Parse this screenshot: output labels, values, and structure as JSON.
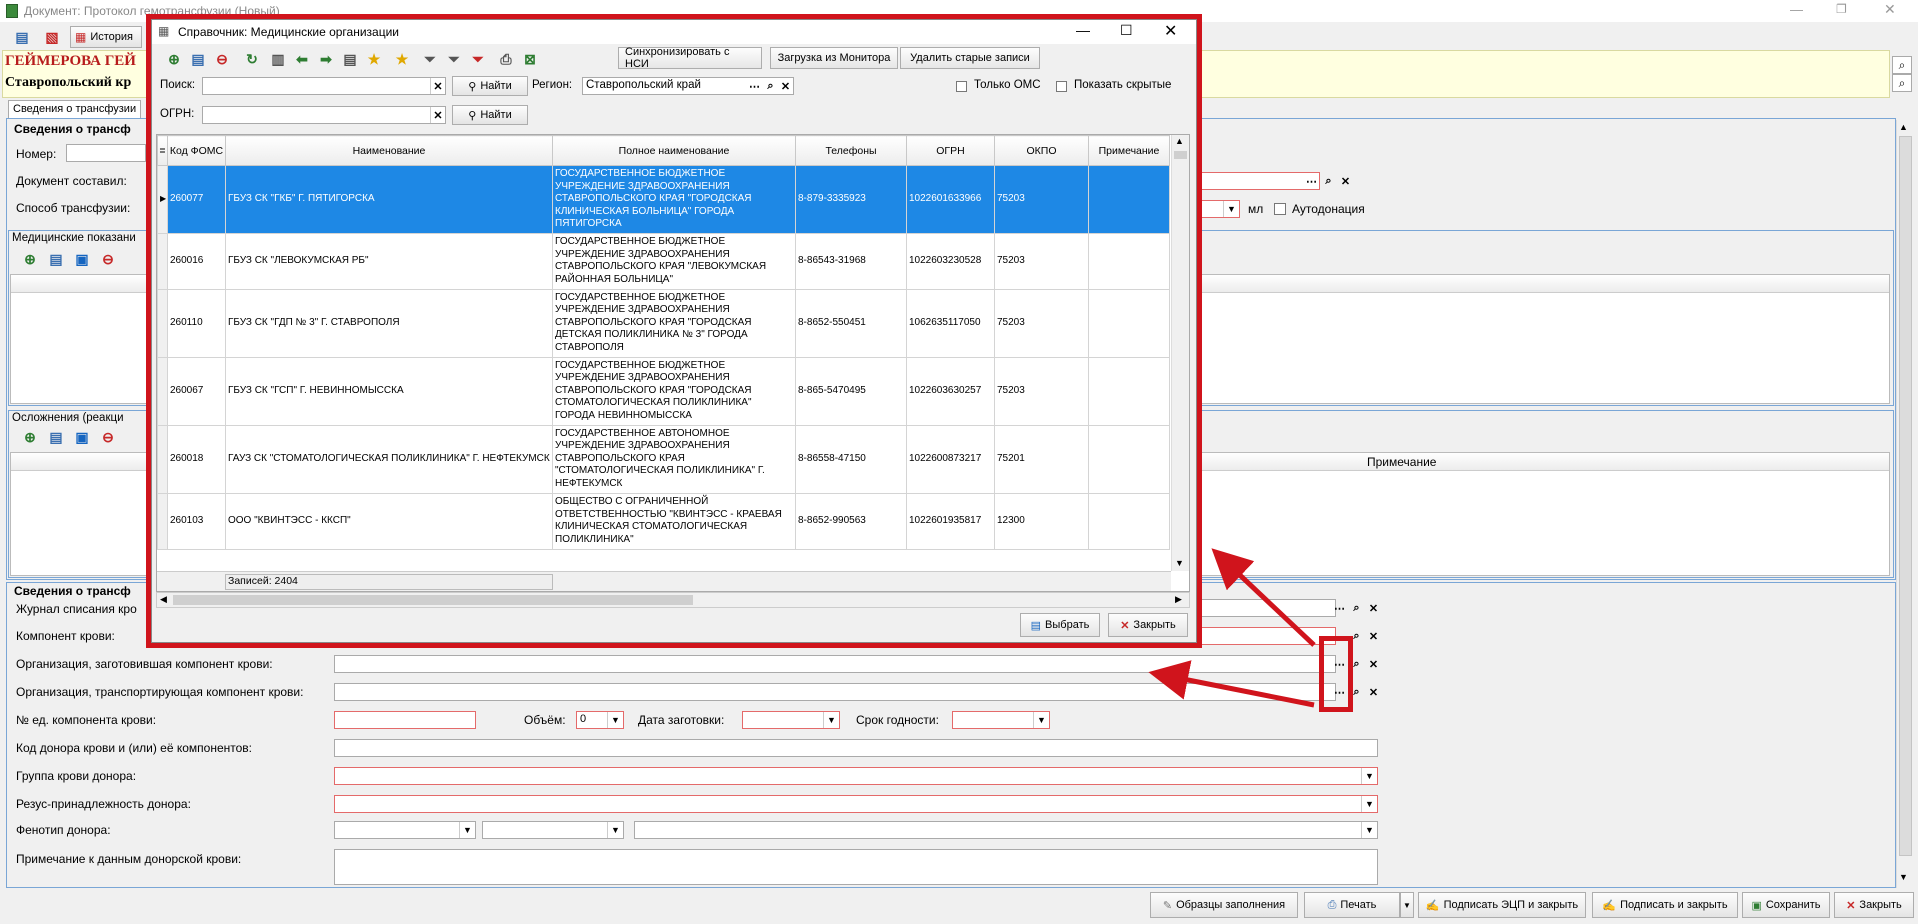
{
  "window": {
    "title": "Документ: Протокол гемотрансфузии (Новый)"
  },
  "toolbar": {
    "history_label": "История"
  },
  "header": {
    "line1": "ГЕЙМЕРОВА ГЕЙ",
    "line2": "Ставропольский кр"
  },
  "tabs": {
    "tab1": "Сведения о трансфузии"
  },
  "section1": {
    "title": "Сведения о трансф",
    "number_label": "Номер:",
    "doc_author_label": "Документ составил:",
    "method_label": "Способ трансфузии:",
    "ml_label": "мл",
    "autodonation_label": "Аутодонация"
  },
  "med_indications": {
    "title": "Медицинские показани"
  },
  "complications": {
    "title": "Осложнения (реакци",
    "note_header": "Примечание"
  },
  "section2": {
    "title": "Сведения о трансф",
    "journal_label": "Журнал списания кро",
    "component_label": "Компонент крови:",
    "org_prepared_label": "Организация, заготовившая компонент крови:",
    "org_transport_label": "Организация, транспортирующая компонент крови:",
    "unit_no_label": "№ ед. компонента крови:",
    "volume_label": "Объём:",
    "volume_value": "0",
    "prep_date_label": "Дата заготовки:",
    "expiry_label": "Срок годности:",
    "donor_code_label": "Код донора крови и (или) её компонентов:",
    "blood_group_label": "Группа крови донора:",
    "rh_label": "Резус-принадлежность донора:",
    "phenotype_label": "Фенотип донора:",
    "donor_note_label": "Примечание к данным донорской крови:"
  },
  "bottom_buttons": {
    "samples": "Образцы заполнения",
    "print": "Печать",
    "sign_ecp_close": "Подписать ЭЦП и закрыть",
    "sign_close": "Подписать и закрыть",
    "save": "Сохранить",
    "close": "Закрыть"
  },
  "dialog": {
    "title": "Справочник: Медицинские организации",
    "sync_nsi": "Синхронизировать с НСИ",
    "load_monitor": "Загрузка из Монитора",
    "delete_old": "Удалить старые записи",
    "search_label": "Поиск:",
    "find_label": "Найти",
    "region_label": "Регион:",
    "region_value": "Ставропольский край",
    "only_oms": "Только ОМС",
    "show_hidden": "Показать скрытые",
    "ogrn_label": "ОГРН:",
    "find_label2": "Найти",
    "records": "Записей: 2404",
    "select_btn": "Выбрать",
    "close_btn": "Закрыть",
    "columns": [
      "Код ФОМС",
      "Наименование",
      "Полное наименование",
      "Телефоны",
      "ОГРН",
      "ОКПО",
      "Примечание"
    ],
    "rows": [
      {
        "code": "260077",
        "name": "ГБУЗ СК \"ГКБ\" Г. ПЯТИГОРСКА",
        "full": "ГОСУДАРСТВЕННОЕ БЮДЖЕТНОЕ УЧРЕЖДЕНИЕ ЗДРАВООХРАНЕНИЯ СТАВРОПОЛЬСКОГО КРАЯ \"ГОРОДСКАЯ КЛИНИЧЕСКАЯ БОЛЬНИЦА\" ГОРОДА ПЯТИГОРСКА",
        "phone": "8-879-3335923",
        "ogrn": "1022601633966",
        "okpo": "75203",
        "note": ""
      },
      {
        "code": "260016",
        "name": "ГБУЗ СК \"ЛЕВОКУМСКАЯ РБ\"",
        "full": "ГОСУДАРСТВЕННОЕ БЮДЖЕТНОЕ УЧРЕЖДЕНИЕ ЗДРАВООХРАНЕНИЯ СТАВРОПОЛЬСКОГО КРАЯ \"ЛЕВОКУМСКАЯ РАЙОННАЯ БОЛЬНИЦА\"",
        "phone": "8-86543-31968",
        "ogrn": "1022603230528",
        "okpo": "75203",
        "note": ""
      },
      {
        "code": "260110",
        "name": "ГБУЗ СК \"ГДП № 3\" Г. СТАВРОПОЛЯ",
        "full": "ГОСУДАРСТВЕННОЕ БЮДЖЕТНОЕ УЧРЕЖДЕНИЕ ЗДРАВООХРАНЕНИЯ СТАВРОПОЛЬСКОГО КРАЯ \"ГОРОДСКАЯ ДЕТСКАЯ ПОЛИКЛИНИКА № 3\" ГОРОДА СТАВРОПОЛЯ",
        "phone": "8-8652-550451",
        "ogrn": "1062635117050",
        "okpo": "75203",
        "note": ""
      },
      {
        "code": "260067",
        "name": "ГБУЗ СК \"ГСП\" Г. НЕВИННОМЫССКА",
        "full": "ГОСУДАРСТВЕННОЕ БЮДЖЕТНОЕ УЧРЕЖДЕНИЕ ЗДРАВООХРАНЕНИЯ СТАВРОПОЛЬСКОГО КРАЯ \"ГОРОДСКАЯ СТОМАТОЛОГИЧЕСКАЯ ПОЛИКЛИНИКА\" ГОРОДА НЕВИННОМЫССКА",
        "phone": "8-865-5470495",
        "ogrn": "1022603630257",
        "okpo": "75203",
        "note": ""
      },
      {
        "code": "260018",
        "name": "ГАУЗ СК \"СТОМАТОЛОГИЧЕСКАЯ ПОЛИКЛИНИКА\" Г. НЕФТЕКУМСК",
        "full": "ГОСУДАРСТВЕННОЕ АВТОНОМНОЕ УЧРЕЖДЕНИЕ ЗДРАВООХРАНЕНИЯ СТАВРОПОЛЬСКОГО КРАЯ \"СТОМАТОЛОГИЧЕСКАЯ ПОЛИКЛИНИКА\" Г. НЕФТЕКУМСК",
        "phone": "8-86558-47150",
        "ogrn": "1022600873217",
        "okpo": "75201",
        "note": ""
      },
      {
        "code": "260103",
        "name": "ООО \"КВИНТЭСС - ККСП\"",
        "full": "ОБЩЕСТВО С ОГРАНИЧЕННОЙ ОТВЕТСТВЕННОСТЬЮ \"КВИНТЭСС - КРАЕВАЯ КЛИНИЧЕСКАЯ СТОМАТОЛОГИЧЕСКАЯ ПОЛИКЛИНИКА\"",
        "phone": "8-8652-990563",
        "ogrn": "1022601935817",
        "okpo": "12300",
        "note": ""
      }
    ]
  },
  "colors": {
    "annotation_red": "#d0141c",
    "selection_blue": "#1e88e5",
    "group_border": "#7aa6d6"
  }
}
